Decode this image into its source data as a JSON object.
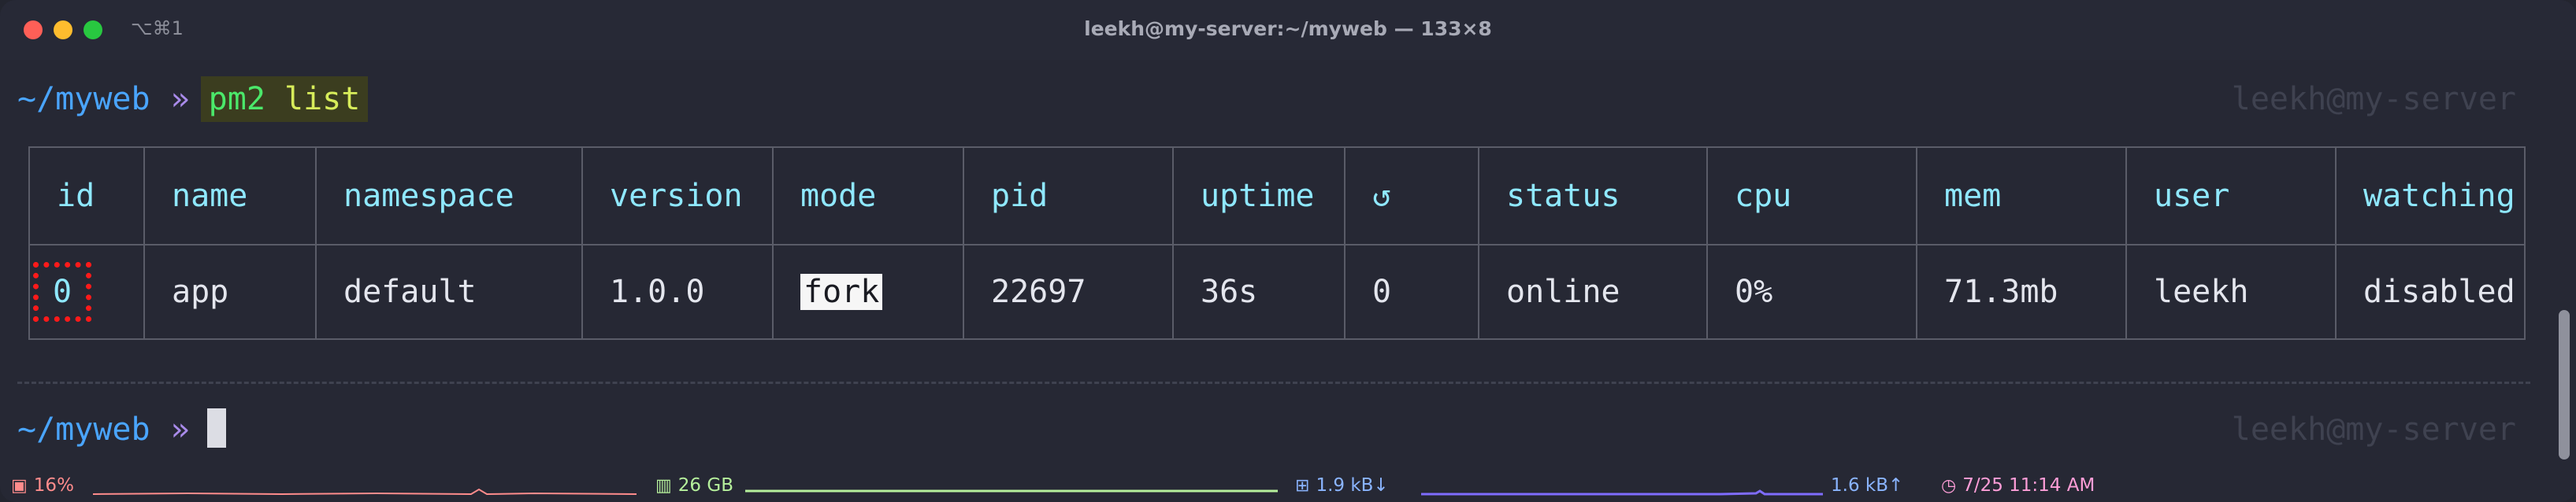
{
  "window": {
    "shortcut": "⌥⌘1",
    "title": "leekh@my-server:~/myweb — 133×8"
  },
  "prompt1": {
    "cwd": "~/myweb",
    "arrow": "»",
    "command_bin": "pm2",
    "command_arg": "list",
    "host": "leekh@my-server"
  },
  "table": {
    "headers": [
      "id",
      "name",
      "namespace",
      "version",
      "mode",
      "pid",
      "uptime",
      "↺",
      "status",
      "cpu",
      "mem",
      "user",
      "watching"
    ],
    "row": {
      "id": "0",
      "name": "app",
      "namespace": "default",
      "version": "1.0.0",
      "mode": "fork",
      "pid": "22697",
      "uptime": "36s",
      "restarts": "0",
      "status": "online",
      "cpu": "0%",
      "mem": "71.3mb",
      "user": "leekh",
      "watching": "disabled"
    }
  },
  "prompt2": {
    "cwd": "~/myweb",
    "arrow": "»",
    "host": "leekh@my-server"
  },
  "statusbar": {
    "cpu": "16%",
    "memory": "26 GB",
    "net_down": "1.9 kB↓",
    "net_up": "1.6 kB↑",
    "datetime": "7/25 11:14 AM"
  },
  "colors": {
    "close": "#ff5f57",
    "minimize": "#febc2e",
    "zoom": "#28c840",
    "cpu": "#ff8c8c",
    "memory": "#b6f09c",
    "network": "#8ab4ff",
    "clock": "#ff9ed8"
  }
}
